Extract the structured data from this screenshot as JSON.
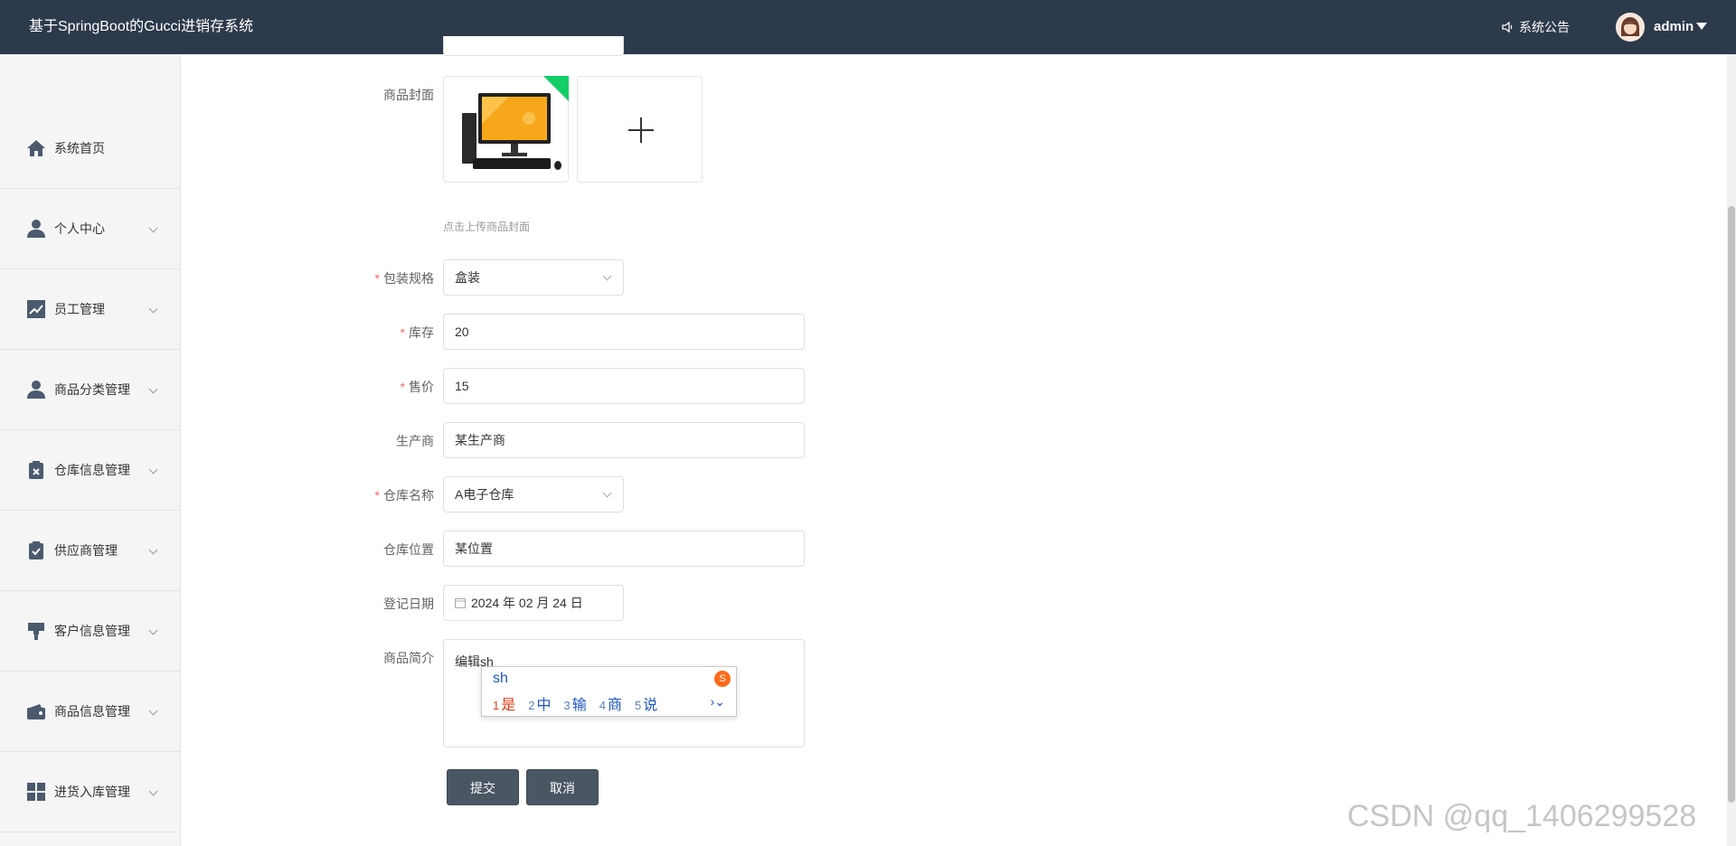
{
  "header": {
    "title": "基于SpringBoot的Gucci进销存系统",
    "notice_label": "系统公告",
    "username": "admin"
  },
  "sidebar": {
    "items": [
      {
        "label": "系统首页",
        "icon": "home-icon"
      },
      {
        "label": "个人中心",
        "icon": "user-icon"
      },
      {
        "label": "员工管理",
        "icon": "chart-icon"
      },
      {
        "label": "商品分类管理",
        "icon": "user-icon"
      },
      {
        "label": "仓库信息管理",
        "icon": "clipboard-x-icon"
      },
      {
        "label": "供应商管理",
        "icon": "clipboard-check-icon"
      },
      {
        "label": "客户信息管理",
        "icon": "brush-icon"
      },
      {
        "label": "商品信息管理",
        "icon": "wallet-icon"
      },
      {
        "label": "进货入库管理",
        "icon": "grid-icon"
      }
    ]
  },
  "form": {
    "cover_label": "商品封面",
    "cover_hint": "点击上传商品封面",
    "packaging_label": "包装规格",
    "packaging_value": "盒装",
    "stock_label": "库存",
    "stock_value": "20",
    "price_label": "售价",
    "price_value": "15",
    "manufacturer_label": "生产商",
    "manufacturer_value": "某生产商",
    "warehouse_label": "仓库名称",
    "warehouse_value": "A电子仓库",
    "location_label": "仓库位置",
    "location_value": "某位置",
    "date_label": "登记日期",
    "date_value": "2024 年 02 月 24 日",
    "intro_label": "商品简介",
    "intro_value": "编辑sh",
    "submit_label": "提交",
    "cancel_label": "取消"
  },
  "ime": {
    "input": "sh",
    "candidates": [
      {
        "num": "1",
        "text": "是"
      },
      {
        "num": "2",
        "text": "中"
      },
      {
        "num": "3",
        "text": "输"
      },
      {
        "num": "4",
        "text": "商"
      },
      {
        "num": "5",
        "text": "说"
      }
    ]
  },
  "watermark": "CSDN @qq_1406299528",
  "colors": {
    "topbar": "#2d3a4b",
    "button": "#4a5664",
    "required": "#f56c6c",
    "upload_badge": "#13ce66"
  }
}
